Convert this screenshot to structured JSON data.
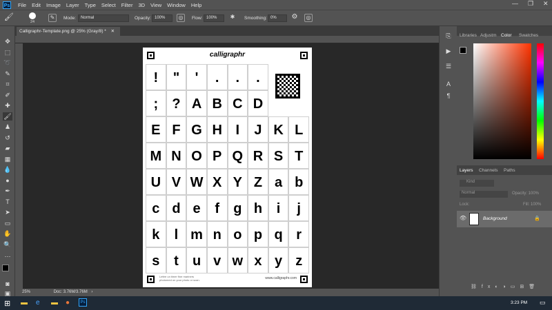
{
  "menu": [
    "File",
    "Edit",
    "Image",
    "Layer",
    "Type",
    "Select",
    "Filter",
    "3D",
    "View",
    "Window",
    "Help"
  ],
  "options": {
    "brush_size": "24",
    "mode_label": "Mode:",
    "mode_value": "Normal",
    "opacity_label": "Opacity:",
    "opacity_value": "100%",
    "flow_label": "Flow:",
    "flow_value": "100%",
    "smoothing_label": "Smoothing:",
    "smoothing_value": "0%"
  },
  "document": {
    "tab_title": "Calligraphr-Template.png @ 25% (Gray/8) *",
    "header": "calligraphr",
    "footer_left_1": "Lettre un timer fine mariners",
    "footer_left_2": "photomed on your photo or scan.",
    "footer_right": "www.calligraphr.com"
  },
  "template": {
    "rows": [
      [
        "!",
        "\"",
        "'",
        ".",
        ".",
        "."
      ],
      [
        ";",
        "?",
        "A",
        "B",
        "C",
        "D"
      ],
      [
        "E",
        "F",
        "G",
        "H",
        "I",
        "J",
        "K",
        "L"
      ],
      [
        "M",
        "N",
        "O",
        "P",
        "Q",
        "R",
        "S",
        "T"
      ],
      [
        "U",
        "V",
        "W",
        "X",
        "Y",
        "Z",
        "a",
        "b"
      ],
      [
        "c",
        "d",
        "e",
        "f",
        "g",
        "h",
        "i",
        "j"
      ],
      [
        "k",
        "l",
        "m",
        "n",
        "o",
        "p",
        "q",
        "r"
      ],
      [
        "s",
        "t",
        "u",
        "v",
        "w",
        "x",
        "y",
        "z"
      ]
    ]
  },
  "status": {
    "zoom": "25%",
    "doc": "Doc: 3.76M/3.76M"
  },
  "panels": {
    "tabs_top": [
      "Libraries",
      "Adjustm",
      "Color",
      "Swatches"
    ],
    "tabs_layers": [
      "Layers",
      "Channels",
      "Paths"
    ],
    "kind_label": "Kind",
    "blend_mode": "Normal",
    "opacity_label": "Opacity: 100%",
    "lock_label": "Lock:",
    "fill_label": "Fill: 100%",
    "layer_name": "Background"
  },
  "taskbar": {
    "time": "3:23 PM"
  },
  "colors": {
    "accent": "#31a8ff",
    "panel": "#535353",
    "canvas": "#282828"
  }
}
